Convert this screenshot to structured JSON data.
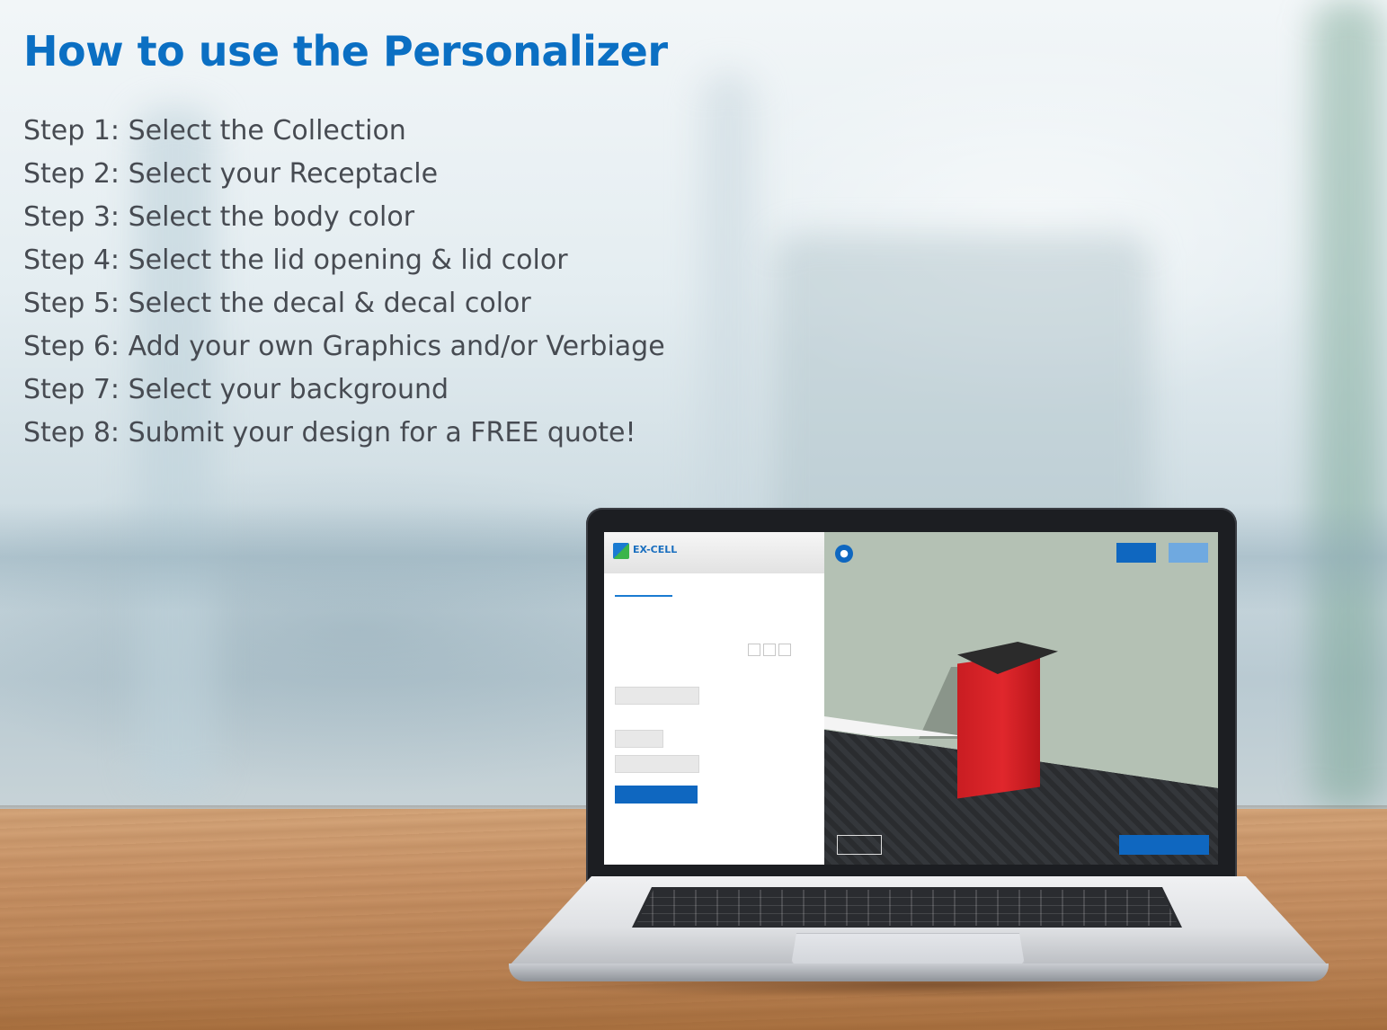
{
  "heading": "How to use the Personalizer",
  "steps": [
    "Step 1: Select the Collection",
    "Step 2: Select your Receptacle",
    "Step 3: Select the body color",
    "Step 4: Select the lid opening & lid color",
    "Step 5: Select the decal & decal color",
    "Step 6: Add your own Graphics and/or Verbiage",
    "Step 7: Select your background",
    "Step 8: Submit your design for a FREE quote!"
  ],
  "colors": {
    "heading": "#0b6fc3",
    "step_text": "#474b52",
    "app_accent": "#0f67c0",
    "receptacle_body": "#e0272c"
  },
  "laptop_screen": {
    "logo_text": "EX-CELL"
  },
  "icons": {
    "view_info": "info-circle-icon"
  }
}
